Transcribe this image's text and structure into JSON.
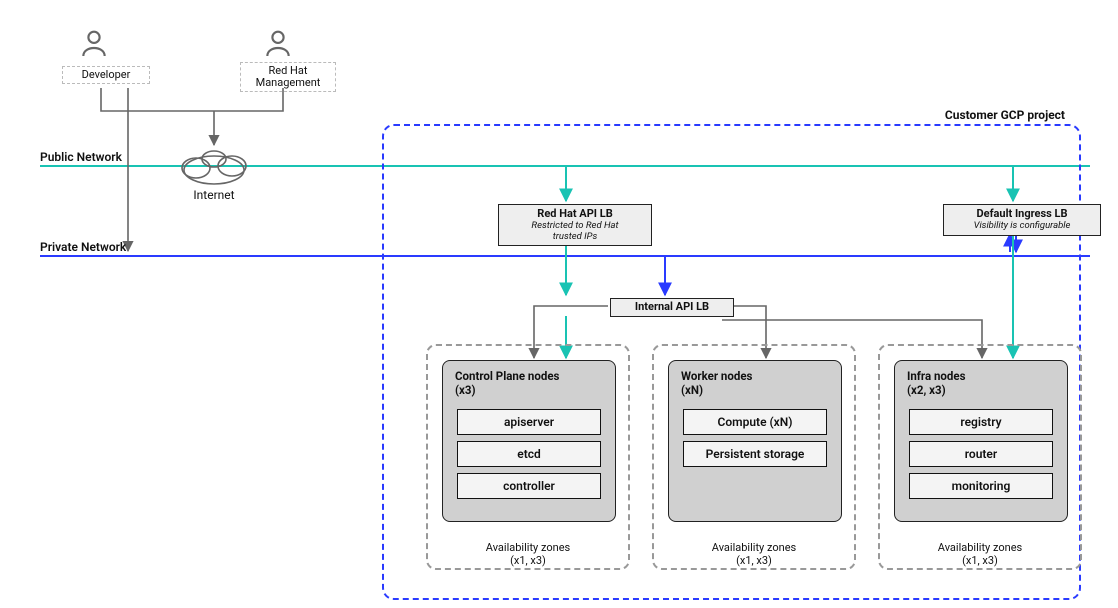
{
  "actors": {
    "developer": "Developer",
    "redhat_mgmt": "Red Hat\nManagement"
  },
  "internet": "Internet",
  "networks": {
    "public": "Public Network",
    "private": "Private Network"
  },
  "gcp_title": "Customer GCP project",
  "lb": {
    "redhat": {
      "title": "Red Hat API LB",
      "sub": "Restricted to Red Hat\ntrusted IPs"
    },
    "ingress": {
      "title": "Default Ingress LB",
      "sub": "Visibility is configurable"
    },
    "internal": "Internal API LB"
  },
  "az": {
    "control": {
      "title": "Control Plane nodes",
      "count": "(x3)",
      "components": [
        "apiserver",
        "etcd",
        "controller"
      ],
      "footer_top": "Availability zones",
      "footer_bottom": "(x1, x3)"
    },
    "worker": {
      "title": "Worker  nodes",
      "count": "(xN)",
      "components": [
        "Compute (xN)",
        "Persistent storage"
      ],
      "footer_top": "Availability zones",
      "footer_bottom": "(x1, x3)"
    },
    "infra": {
      "title": "Infra nodes",
      "count": "(x2, x3)",
      "components": [
        "registry",
        "router",
        "monitoring"
      ],
      "footer_top": "Availability zones",
      "footer_bottom": "(x1, x3)"
    }
  }
}
